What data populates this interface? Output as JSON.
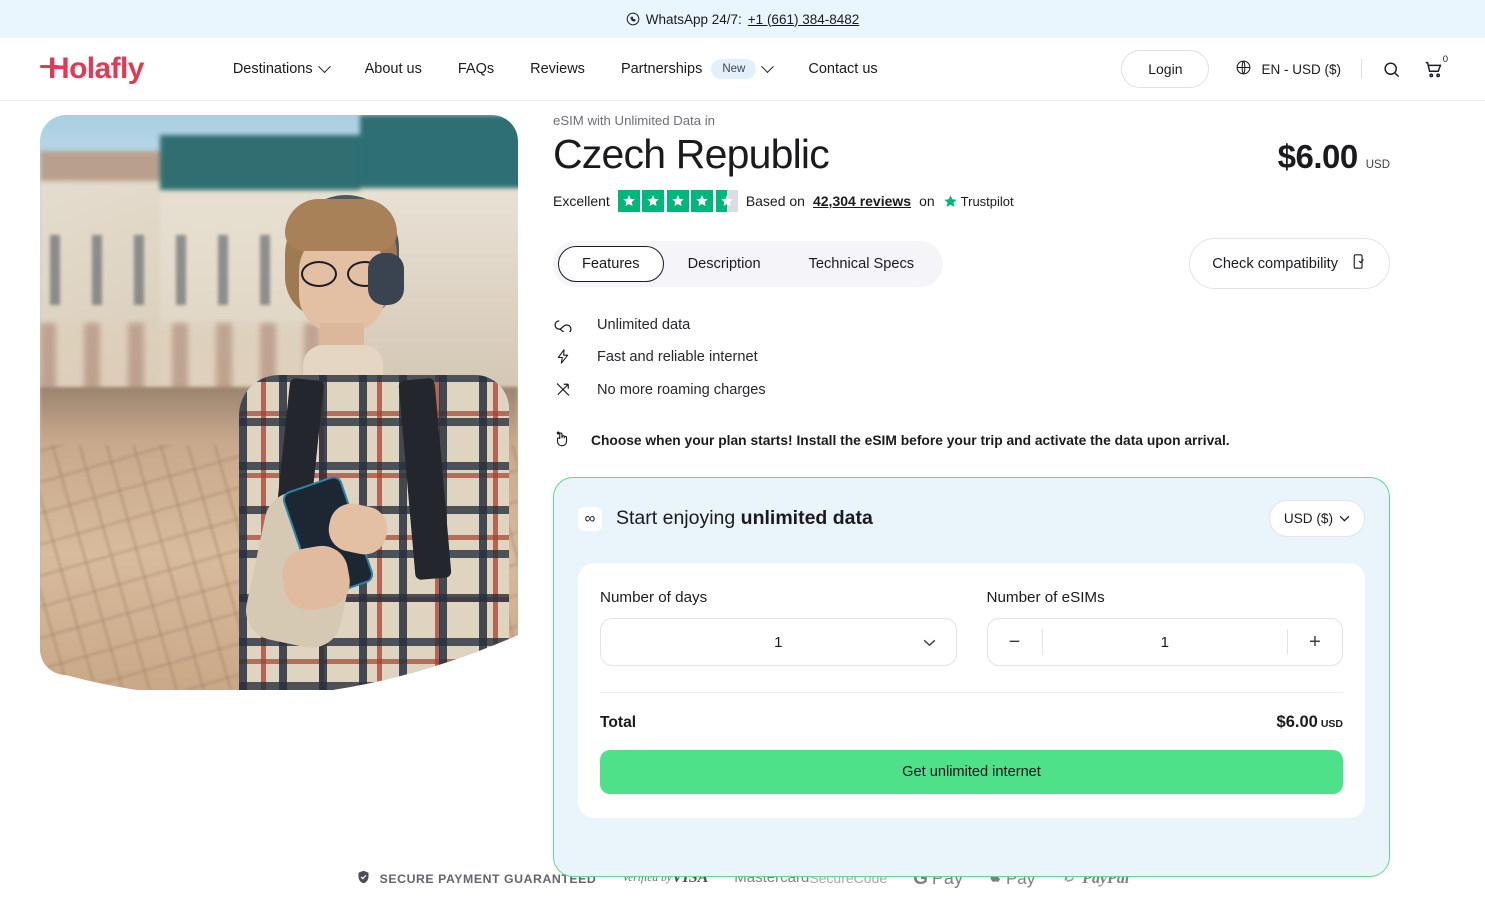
{
  "topbar": {
    "icon": "whatsapp-icon",
    "text": "WhatsApp 24/7:",
    "phone": "+1 (661) 384-8482"
  },
  "header": {
    "logo": "Holafly",
    "nav": [
      {
        "label": "Destinations",
        "has_chevron": true,
        "badge": ""
      },
      {
        "label": "About us",
        "has_chevron": false,
        "badge": ""
      },
      {
        "label": "FAQs",
        "has_chevron": false,
        "badge": ""
      },
      {
        "label": "Reviews",
        "has_chevron": false,
        "badge": ""
      },
      {
        "label": "Partnerships",
        "has_chevron": true,
        "badge": "New"
      },
      {
        "label": "Contact us",
        "has_chevron": false,
        "badge": ""
      }
    ],
    "login_label": "Login",
    "locale": "EN - USD ($)",
    "cart_count": "0"
  },
  "product": {
    "eyebrow": "eSIM with Unlimited Data in",
    "title": "Czech Republic",
    "price": "$6.00",
    "currency": "USD",
    "trust": {
      "rating_word": "Excellent",
      "rating_value": 4.5,
      "based_on": "Based on",
      "reviews": "42,304 reviews",
      "on": "on",
      "provider": "Trustpilot"
    },
    "tabs": [
      {
        "label": "Features",
        "active": true
      },
      {
        "label": "Description",
        "active": false
      },
      {
        "label": "Technical Specs",
        "active": false
      }
    ],
    "compatibility_label": "Check compatibility",
    "features": [
      {
        "icon": "infinity-icon",
        "glyph": "∞",
        "label": "Unlimited data"
      },
      {
        "icon": "bolt-icon",
        "glyph": "⚡",
        "label": "Fast and reliable internet"
      },
      {
        "icon": "no-roaming-icon",
        "glyph": "↗",
        "label": "No more roaming charges"
      }
    ],
    "note": {
      "icon": "tap-hand-icon",
      "text": "Choose when your plan starts! Install the eSIM before your trip and activate the data upon arrival."
    }
  },
  "buycard": {
    "title_prefix": "Start enjoying",
    "title_strong": "unlimited data",
    "infinity_glyph": "∞",
    "currency_selector": "USD ($)",
    "days_label": "Number of days",
    "days_value": "1",
    "esims_label": "Number of eSIMs",
    "esims_value": "1",
    "minus_label": "−",
    "plus_label": "+",
    "total_label": "Total",
    "total_value": "$6.00",
    "total_currency": "USD",
    "cta_label": "Get unlimited internet",
    "border_color": "#62d98c",
    "background_color": "#e9f4fb",
    "cta_color": "#4fe08a"
  },
  "payments": {
    "secure_text": "SECURE PAYMENT GUARANTEED",
    "methods": [
      {
        "name": "visa",
        "line1": "Verified by",
        "line2": "VISA"
      },
      {
        "name": "mastercard",
        "line1": "Mastercard",
        "line2": "SecureCode"
      },
      {
        "name": "gpay",
        "line1": "G",
        "line2": "Pay"
      },
      {
        "name": "applepay",
        "line1": "",
        "line2": "Pay"
      },
      {
        "name": "paypal",
        "line1": "P",
        "line2": "PayPal"
      }
    ]
  },
  "colors": {
    "brand": "#e23a54",
    "topbar_bg": "#eaf6fd",
    "trust_green": "#00b67a",
    "cta_green": "#4fe08a"
  }
}
